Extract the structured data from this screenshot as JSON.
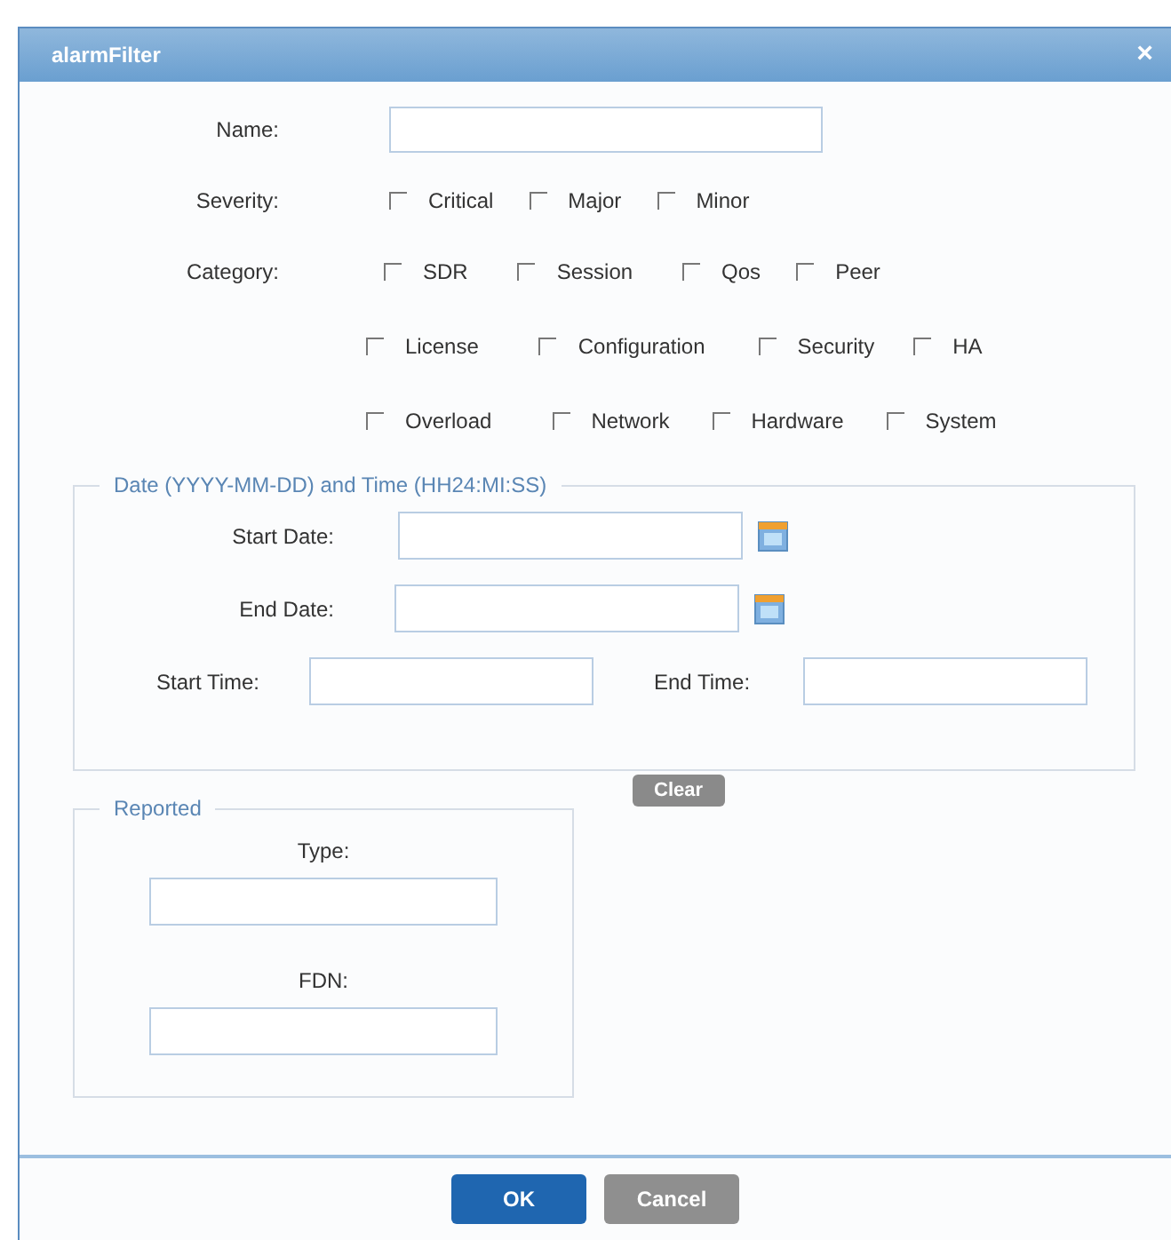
{
  "window": {
    "title": "alarmFilter",
    "close": "×"
  },
  "name": {
    "label": "Name:"
  },
  "severity": {
    "label": "Severity:",
    "options": [
      {
        "label": "Critical",
        "checked": false
      },
      {
        "label": "Major",
        "checked": false
      },
      {
        "label": "Minor",
        "checked": false
      }
    ]
  },
  "category": {
    "label": "Category:",
    "rows": [
      [
        {
          "label": "SDR",
          "checked": false
        },
        {
          "label": "Session",
          "checked": false
        },
        {
          "label": "Qos",
          "checked": false
        },
        {
          "label": "Peer",
          "checked": false
        }
      ],
      [
        {
          "label": "License",
          "checked": false
        },
        {
          "label": "Configuration",
          "checked": false
        },
        {
          "label": "Security",
          "checked": false
        },
        {
          "label": "HA",
          "checked": false
        }
      ],
      [
        {
          "label": "Overload",
          "checked": false
        },
        {
          "label": "Network",
          "checked": false
        },
        {
          "label": "Hardware",
          "checked": false
        },
        {
          "label": "System",
          "checked": false
        }
      ]
    ]
  },
  "date_time": {
    "legend": "Date (YYYY-MM-DD) and Time (HH24:MI:SS)",
    "start_date": "Start Date:",
    "end_date": "End Date:",
    "start_time": "Start Time:",
    "end_time": "End Time:",
    "clear": "Clear"
  },
  "reported": {
    "legend": "Reported",
    "type": "Type:",
    "fdn": "FDN:"
  },
  "buttons": {
    "ok": "OK",
    "cancel": "Cancel"
  }
}
